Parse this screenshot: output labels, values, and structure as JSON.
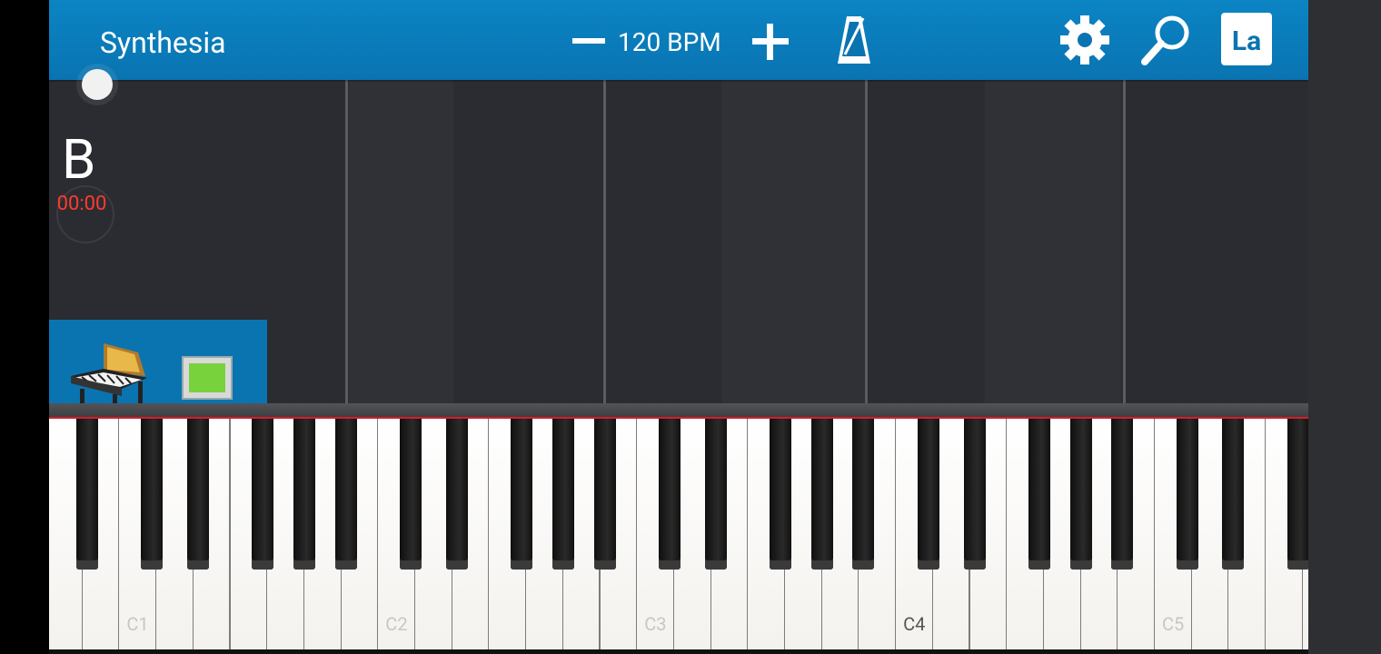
{
  "topbar": {
    "title": "Synthesia",
    "bpm_label": "120 BPM",
    "language_button": "La"
  },
  "icons": {
    "bpm_decrease": "minus-icon",
    "bpm_increase": "plus-icon",
    "metronome": "metronome-icon",
    "settings": "gear-icon",
    "search": "magnifier-icon",
    "instrument": "grand-piano-icon"
  },
  "player": {
    "note_letter": "B",
    "timer": "00:00"
  },
  "instrument": {
    "swatch_color": "#78d23c"
  },
  "keyboard": {
    "octave_labels": [
      "C1",
      "C2",
      "C3",
      "C4",
      "C5"
    ]
  },
  "colors": {
    "topbar": "#0a74b1",
    "background": "#2b2c31",
    "timer_text": "#ff3b2f",
    "keyboard_line": "#d81b2b"
  }
}
